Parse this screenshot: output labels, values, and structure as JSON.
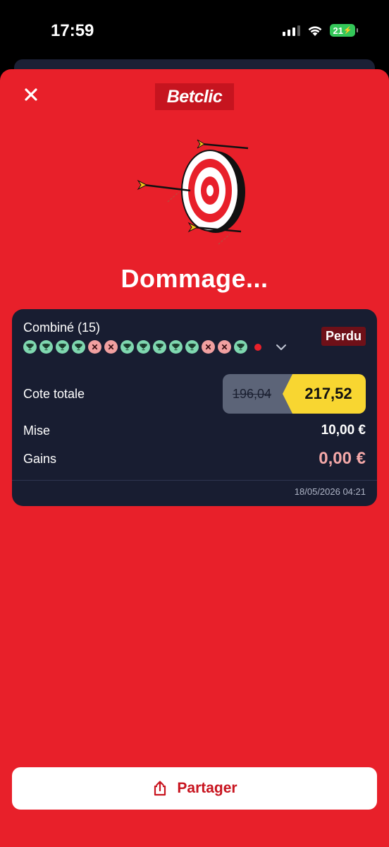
{
  "status_bar": {
    "time": "17:59",
    "battery": "21"
  },
  "header": {
    "brand": "Betclic"
  },
  "result": {
    "headline": "Dommage..."
  },
  "bet": {
    "type": "Combiné (15)",
    "status": "Perdu",
    "picks": [
      "win",
      "win",
      "win",
      "win",
      "loss",
      "loss",
      "win",
      "win",
      "win",
      "win",
      "win",
      "loss",
      "loss",
      "win",
      "pending"
    ],
    "cote_label": "Cote totale",
    "cote_old": "196,04",
    "cote_new": "217,52",
    "mise_label": "Mise",
    "mise_value": "10,00 €",
    "gains_label": "Gains",
    "gains_value": "0,00 €",
    "timestamp": "18/05/2026 04:21"
  },
  "actions": {
    "share_label": "Partager"
  },
  "colors": {
    "brand_red": "#e8202a",
    "card_bg": "#181d31",
    "odds_yellow": "#f8d631",
    "win": "#7fd8b0",
    "loss": "#f1a0a0"
  },
  "icons": {
    "close": "close-icon",
    "share": "share-icon",
    "expand": "chevron-down-icon",
    "target": "target-icon"
  }
}
